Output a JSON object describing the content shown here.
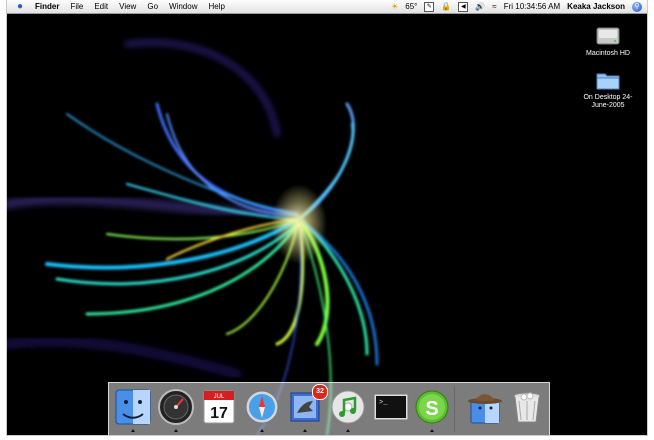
{
  "menubar": {
    "app_name": "Finder",
    "menus": [
      "File",
      "Edit",
      "View",
      "Go",
      "Window",
      "Help"
    ],
    "temperature": "65°",
    "clock": "Fri 10:34:56 AM",
    "user": "Keaka Jackson"
  },
  "desktop": {
    "icons": [
      {
        "label": "Macintosh HD",
        "icon": "hard-drive-icon"
      },
      {
        "label": "On Desktop 24-June-2005",
        "icon": "folder-icon"
      }
    ]
  },
  "dock": {
    "items": [
      {
        "name": "Finder",
        "icon": "finder-icon",
        "running": true
      },
      {
        "name": "Dashboard",
        "icon": "dashboard-icon",
        "running": true
      },
      {
        "name": "iCal",
        "icon": "ical-icon",
        "date": "17",
        "month": "JUL",
        "running": false
      },
      {
        "name": "Safari",
        "icon": "safari-icon",
        "running": true
      },
      {
        "name": "Mail",
        "icon": "mail-icon",
        "badge": "32",
        "running": true
      },
      {
        "name": "iTunes",
        "icon": "itunes-icon",
        "running": true
      },
      {
        "name": "Terminal",
        "icon": "terminal-icon",
        "running": false
      },
      {
        "name": "Skype",
        "icon": "skype-icon",
        "running": true
      },
      {
        "name": "Inspector",
        "icon": "spy-finder-icon",
        "running": false
      },
      {
        "name": "Trash",
        "icon": "trash-icon",
        "running": false
      }
    ]
  },
  "colors": {
    "accent": "#2a5bd7",
    "badge": "#e2231a",
    "wallpaper": "#000000"
  }
}
